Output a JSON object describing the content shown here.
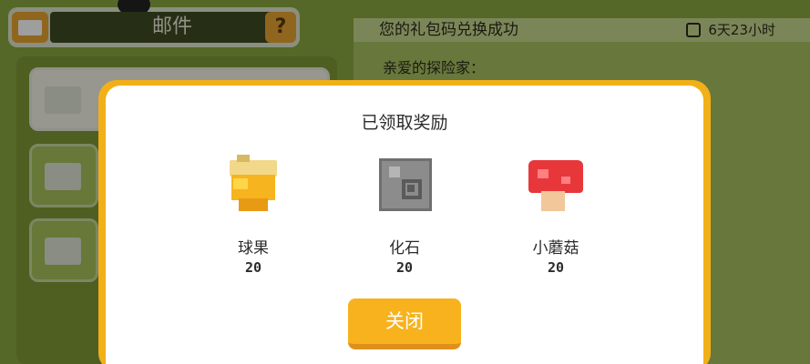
{
  "mail": {
    "title": "邮件",
    "help_label": "?"
  },
  "detail": {
    "title": "您的礼包码兑换成功",
    "time_left": "6天23小时",
    "body_line1": "亲爱的探险家："
  },
  "modal": {
    "title": "已领取奖励",
    "close_label": "关闭",
    "rewards": [
      {
        "name": "球果",
        "count": "20",
        "icon": "nut-icon"
      },
      {
        "name": "化石",
        "count": "20",
        "icon": "fossil-icon"
      },
      {
        "name": "小蘑菇",
        "count": "20",
        "icon": "mushroom-icon"
      }
    ]
  },
  "colors": {
    "accent": "#f7b21d",
    "modal_bg": "#ffffff",
    "scene_bg": "#55692a"
  }
}
